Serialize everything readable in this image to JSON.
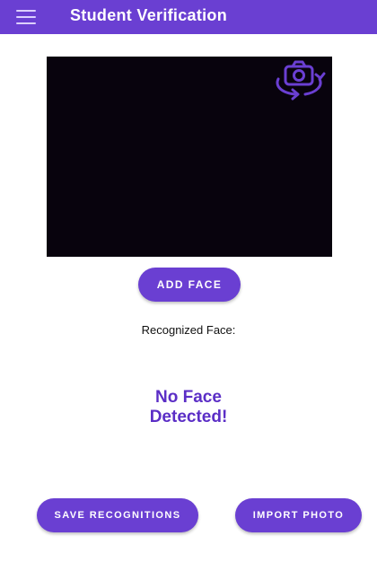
{
  "app_bar": {
    "title": "Student Verification",
    "menu_icon": "hamburger-menu-icon",
    "background_color": "#6a3fd2"
  },
  "camera": {
    "switch_icon": "switch-camera-icon",
    "accent_color": "#6a3fd2"
  },
  "actions": {
    "add_face_label": "ADD FACE",
    "save_label": "SAVE RECOGNITIONS",
    "import_label": "IMPORT PHOTO"
  },
  "recognition": {
    "label": "Recognized Face:",
    "result_line1": "No Face",
    "result_line2": "Detected!",
    "result_color": "#5b2ec6"
  }
}
